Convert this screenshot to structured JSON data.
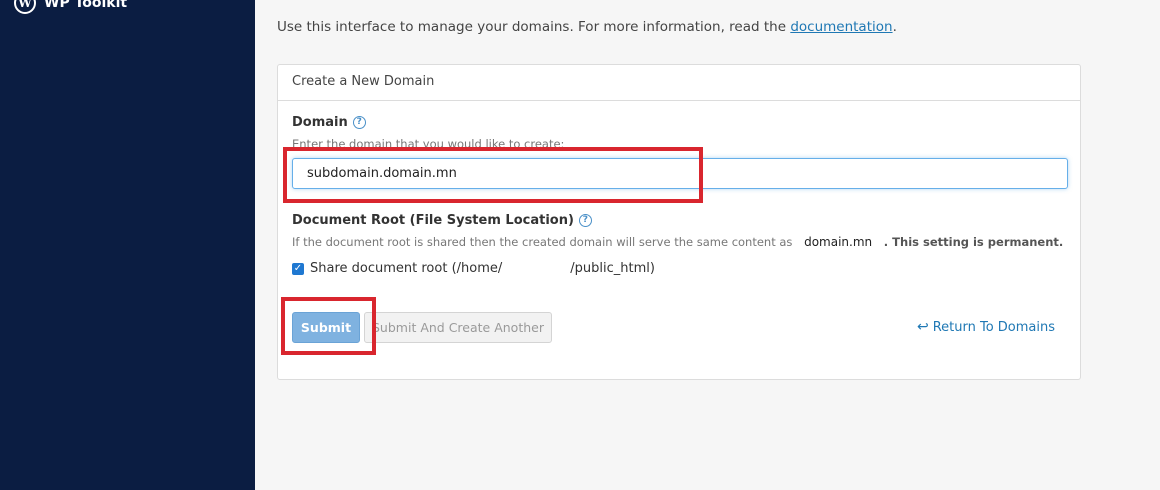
{
  "sidebar": {
    "item_label": "WP Toolkit",
    "icon": "wordpress-icon"
  },
  "intro": {
    "text": "Use this interface to manage your domains. For more information, read the ",
    "link": "documentation",
    "end": "."
  },
  "panel": {
    "title": "Create a New Domain"
  },
  "domain": {
    "label": "Domain",
    "hint": "Enter the domain that you would like to create:",
    "value": "subdomain.domain.mn"
  },
  "docroot": {
    "label": "Document Root (File System Location)",
    "info_prefix": "If the document root is shared then the created domain will serve the same content as",
    "domain_value": "domain.mn",
    "permanent": ". This setting is permanent.",
    "share_prefix": "Share document root (/home/",
    "share_suffix": "/public_html)"
  },
  "buttons": {
    "submit": "Submit",
    "submit_another": "Submit And Create Another",
    "return": "Return To Domains"
  },
  "colors": {
    "sidebar": "#0b1d42",
    "accent": "#1f78b4",
    "highlight": "#d9262e"
  }
}
